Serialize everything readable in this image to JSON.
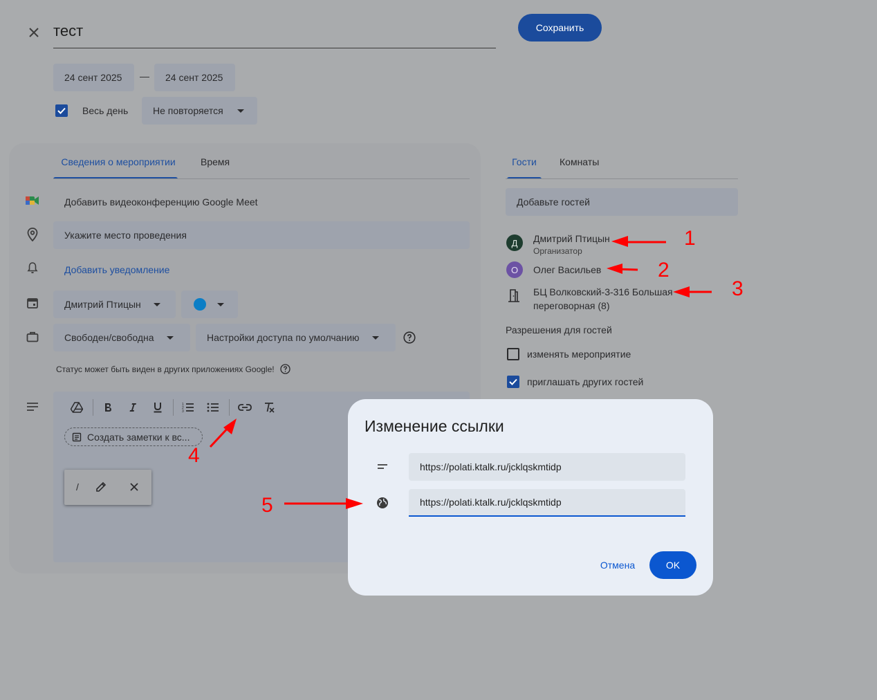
{
  "header": {
    "title": "тест",
    "save_label": "Сохранить",
    "start_date": "24 сент 2025",
    "dash": "—",
    "end_date": "24 сент 2025",
    "all_day_label": "Весь день",
    "all_day_checked": true,
    "repeat_label": "Не повторяется"
  },
  "left_panel": {
    "tabs": [
      {
        "label": "Сведения о мероприятии",
        "active": true
      },
      {
        "label": "Время",
        "active": false
      }
    ],
    "meet_label": "Добавить видеоконференцию Google Meet",
    "location_placeholder": "Укажите место проведения",
    "add_notification": "Добавить уведомление",
    "calendar_owner": "Дмитрий Птицын",
    "color": "#0b7ec6",
    "busy_status": "Свободен/свободна",
    "visibility": "Настройки доступа по умолчанию",
    "status_note": "Статус может быть виден в других приложениях Google!",
    "notes_chip": "Создать заметки к вс...",
    "link_popup_label": "/"
  },
  "right_panel": {
    "tabs": [
      {
        "label": "Гости",
        "active": true
      },
      {
        "label": "Комнаты",
        "active": false
      }
    ],
    "add_guests_placeholder": "Добавьте гостей",
    "guests": [
      {
        "initial": "Д",
        "name": "Дмитрий Птицын",
        "role": "Организатор",
        "color": "#1e3d2f"
      },
      {
        "initial": "О",
        "name": "Олег Васильев",
        "role": "",
        "color": "#6c52a4"
      }
    ],
    "room": "БЦ Волковский-3-316 Большая переговорная (8)",
    "room_line1": "БЦ Волковский-3-316 Большая",
    "room_line2": "переговорная (8)",
    "permissions_title": "Разрешения для гостей",
    "permissions": [
      {
        "label": "изменять мероприятие",
        "checked": false
      },
      {
        "label": "приглашать других гостей",
        "checked": true
      }
    ]
  },
  "dialog": {
    "title": "Изменение ссылки",
    "text_value": "https://polati.ktalk.ru/jcklqskmtidp",
    "url_value": "https://polati.ktalk.ru/jcklqskmtidp",
    "cancel_label": "Отмена",
    "ok_label": "OK"
  },
  "annotations": [
    "1",
    "2",
    "3",
    "4",
    "5"
  ],
  "colors": {
    "accent": "#0b57d0",
    "overlay_bg": "#a9abad",
    "annotation": "#ff0000"
  }
}
